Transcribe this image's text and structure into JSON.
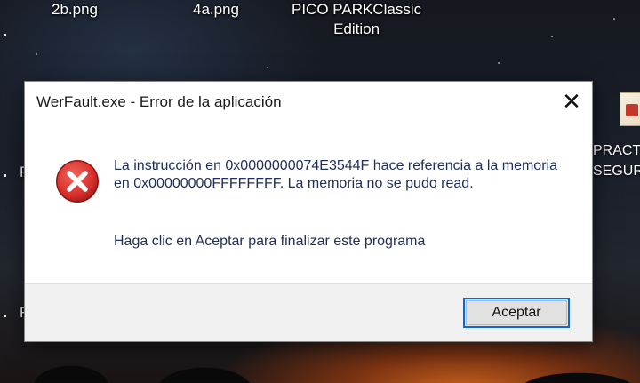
{
  "desktop": {
    "icons": [
      {
        "label": "2b.png"
      },
      {
        "label": "4a.png"
      },
      {
        "label_line1": "PICO PARKClassic",
        "label_line2": "Edition"
      }
    ],
    "right_partial_labels": [
      "PRACT",
      "SEGUR"
    ],
    "left_fragments": [
      "F",
      "F"
    ]
  },
  "dialog": {
    "title": "WerFault.exe - Error de la aplicación",
    "close_glyph": "✕",
    "icon": "error-icon",
    "message": "La instrucción en 0x0000000074E3544F hace referencia a la memoria en 0x00000000FFFFFFFF. La memoria no se pudo read.",
    "message2": "Haga clic en Aceptar para finalizar este programa",
    "ok_label": "Aceptar",
    "colors": {
      "accent": "#0a6ad6",
      "error_red": "#d9302c",
      "text_blue": "#1f2e5a"
    }
  }
}
